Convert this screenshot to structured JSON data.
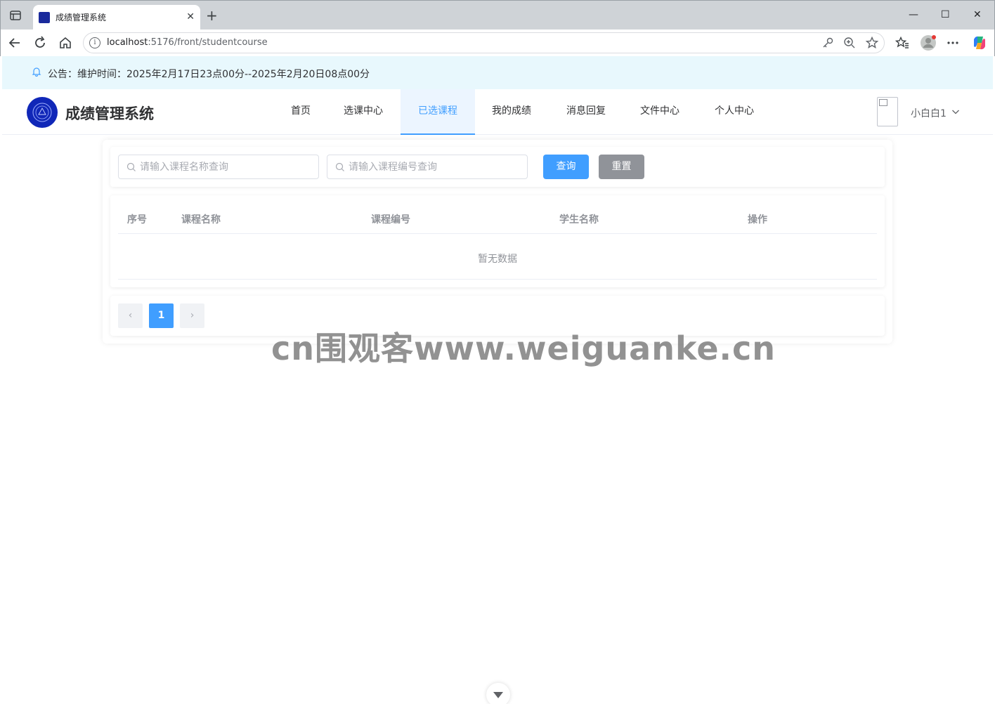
{
  "browser": {
    "tab_title": "成绩管理系统",
    "tab_close": "✕",
    "new_tab": "+",
    "win_min": "—",
    "win_max": "☐",
    "win_close": "✕",
    "url_host": "localhost",
    "url_rest": ":5176/front/studentcourse",
    "url_info": "i"
  },
  "notice": {
    "text": "公告：维护时间：2025年2月17日23点00分--2025年2月20日08点00分"
  },
  "header": {
    "site_title": "成绩管理系统",
    "menu": [
      {
        "label": "首页"
      },
      {
        "label": "选课中心"
      },
      {
        "label": "已选课程"
      },
      {
        "label": "我的成绩"
      },
      {
        "label": "消息回复"
      },
      {
        "label": "文件中心"
      },
      {
        "label": "个人中心"
      }
    ],
    "active_menu": "已选课程",
    "username": "小白白1"
  },
  "search": {
    "course_name_placeholder": "请输入课程名称查询",
    "course_code_placeholder": "请输入课程编号查询",
    "query_label": "查询",
    "reset_label": "重置"
  },
  "table": {
    "columns": [
      "序号",
      "课程名称",
      "课程编号",
      "学生名称",
      "操作"
    ],
    "rows": [],
    "empty_text": "暂无数据"
  },
  "pagination": {
    "current_page": "1",
    "prev": "‹",
    "next": "›"
  },
  "watermark": "cn围观客www.weiguanke.cn",
  "colors": {
    "primary": "#409eff",
    "notice_bg": "#e8f8fd",
    "reset_button": "#909399"
  }
}
